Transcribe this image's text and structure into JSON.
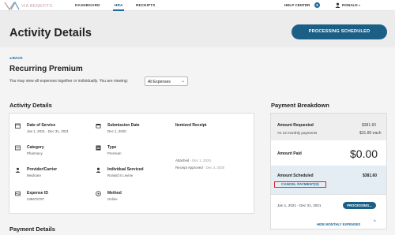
{
  "nav": {
    "logo_text": "VIA BENEFITS",
    "items": [
      "DASHBOARD",
      "HRA",
      "RECEIPTS"
    ],
    "active": "HRA",
    "help_label": "HELP CENTER",
    "help_count": "5",
    "user_name": "RONALD",
    "user_caret": "▾"
  },
  "header": {
    "title": "Activity Details",
    "status_button": "PROCESSING SCHEDULED"
  },
  "main": {
    "back_label": "◂ BACK",
    "title": "Recurring Premium",
    "viewing_text": "You may view all expenses together or individually. You are viewing:",
    "view_select": "All Expenses",
    "section_title": "Activity Details",
    "fields": [
      {
        "label": "Date of Service",
        "value": "Jan 1, 2021 - Dec 31, 2021",
        "icon": "calendar-icon"
      },
      {
        "label": "Submission Date",
        "value": "Dec 1, 2020",
        "icon": "calendar-icon"
      },
      {
        "label": "Category",
        "value": "Pharmacy",
        "icon": "category-icon"
      },
      {
        "label": "Type",
        "value": "Premium",
        "icon": "type-icon"
      },
      {
        "label": "Provider/Carrier",
        "value": "Medicare",
        "icon": "provider-icon"
      },
      {
        "label": "Individual Serviced",
        "value": "Ronald S Levine",
        "icon": "person-icon"
      },
      {
        "label": "Expense ID",
        "value": "238675797",
        "icon": "id-card-icon"
      },
      {
        "label": "Method",
        "value": "Online",
        "icon": "method-icon"
      }
    ],
    "itemized_label": "Itemized Receipt",
    "attached_label": "Attached",
    "attached_date": " - Dec 1, 2020",
    "approved_label": "Receipt Approved",
    "approved_date": " - Dec 4, 2020",
    "payment_details_title": "Payment Details"
  },
  "payment": {
    "title": "Payment Breakdown",
    "requested_label": "Amount Requested",
    "requested_amount": "$381.60",
    "requested_sub": "As 12 monthly payments",
    "requested_sub_amount": "$31.80 each",
    "paid_label": "Amount Paid",
    "paid_amount": "$0.00",
    "scheduled_label": "Amount Scheduled",
    "scheduled_amount": "$381.60",
    "cancel_label": "CANCEL PAYMENT(S)",
    "date_range": "Jan 1, 2021 - Dec 31, 2021",
    "processing_label": "PROCESSING...",
    "hide_label": "HIDE MONTHLY EXPENSES",
    "hide_caret": "^"
  },
  "colors": {
    "primary": "#1c5f86",
    "link": "#1a6a9a",
    "cancel_border": "#d7262c",
    "logo": "#c9a0a8"
  }
}
